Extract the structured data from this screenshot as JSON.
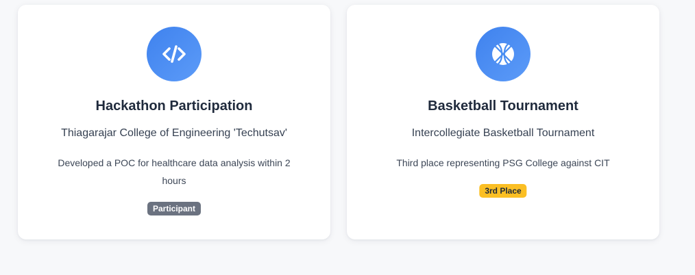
{
  "cards": [
    {
      "icon": "code-icon",
      "title": "Hackathon Participation",
      "subtitle": "Thiagarajar College of Engineering 'Techutsav'",
      "description": "Developed a POC for healthcare data analysis within 2 hours",
      "badge": "Participant",
      "badge_color": "#6b7280"
    },
    {
      "icon": "basketball-icon",
      "title": "Basketball Tournament",
      "subtitle": "Intercollegiate Basketball Tournament",
      "description": "Third place representing PSG College against CIT",
      "badge": "3rd Place",
      "badge_color": "#fbbf24"
    }
  ],
  "colors": {
    "page_background": "#f7f8fa",
    "icon_gradient_start": "#3f82ee",
    "icon_gradient_end": "#5c9bf8",
    "title_text": "#1f2a3c"
  }
}
